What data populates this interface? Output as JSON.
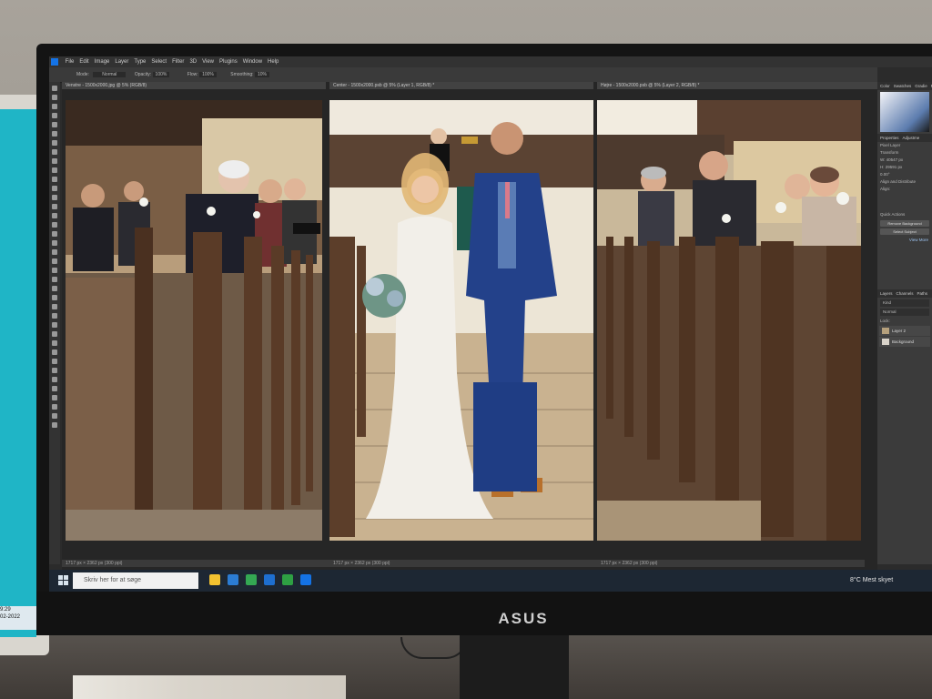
{
  "app": {
    "menu": [
      "File",
      "Edit",
      "Image",
      "Layer",
      "Type",
      "Select",
      "Filter",
      "3D",
      "View",
      "Plugins",
      "Window",
      "Help"
    ],
    "options": {
      "mode_label": "Mode:",
      "mode_value": "Normal",
      "opacity_label": "Opacity:",
      "opacity_value": "100%",
      "flow_label": "Flow:",
      "flow_value": "100%",
      "smoothing_label": "Smoothing:",
      "smoothing_value": "10%"
    }
  },
  "documents": [
    {
      "tab": "Venstre - 1500x2000.jpg @ 5% (RGB/8)",
      "status": "1717 px × 2362 px (300 ppi)"
    },
    {
      "tab": "Center - 1500x2000.psb @ 5% (Layer 1, RGB/8) *",
      "status": "1717 px × 2362 px (300 ppi)"
    },
    {
      "tab": "Højre - 1500x2000.psb @ 5% (Layer 2, RGB/8) *",
      "status": "1717 px × 2362 px (300 ppi)"
    }
  ],
  "panels": {
    "color_tabs": [
      "Color",
      "Swatches",
      "Gradie",
      "Patter"
    ],
    "properties_tabs": [
      "Properties",
      "Adjustme"
    ],
    "pixel_layer": "Pixel Layer",
    "transform": "Transform",
    "w": "W: 40547 px",
    "h": "H: 29591 px",
    "angle": "0.00°",
    "align": "Align and Distribute",
    "align_sub": "Align:",
    "quick_actions": "Quick Actions",
    "btn_remove_bg": "Remove Background",
    "btn_select_subject": "Select Subject",
    "view_more": "View More",
    "layers_tabs": [
      "Layers",
      "Channels",
      "Paths"
    ],
    "kind": "Kind",
    "blend": "Normal",
    "lock": "Lock:",
    "layers": [
      {
        "name": "Layer 2"
      },
      {
        "name": "Background"
      }
    ]
  },
  "taskbar": {
    "search_placeholder": "Skriv her for at søge",
    "weather": "8°C Mest skyet",
    "app_colors": [
      "#f2c230",
      "#2b7cd3",
      "#34a853",
      "#1e6fd0",
      "#2ea043",
      "#1473e6"
    ]
  },
  "second_monitor": {
    "date_line1": "9:29",
    "date_line2": "02-2022"
  },
  "monitor_brand": "ASUS"
}
